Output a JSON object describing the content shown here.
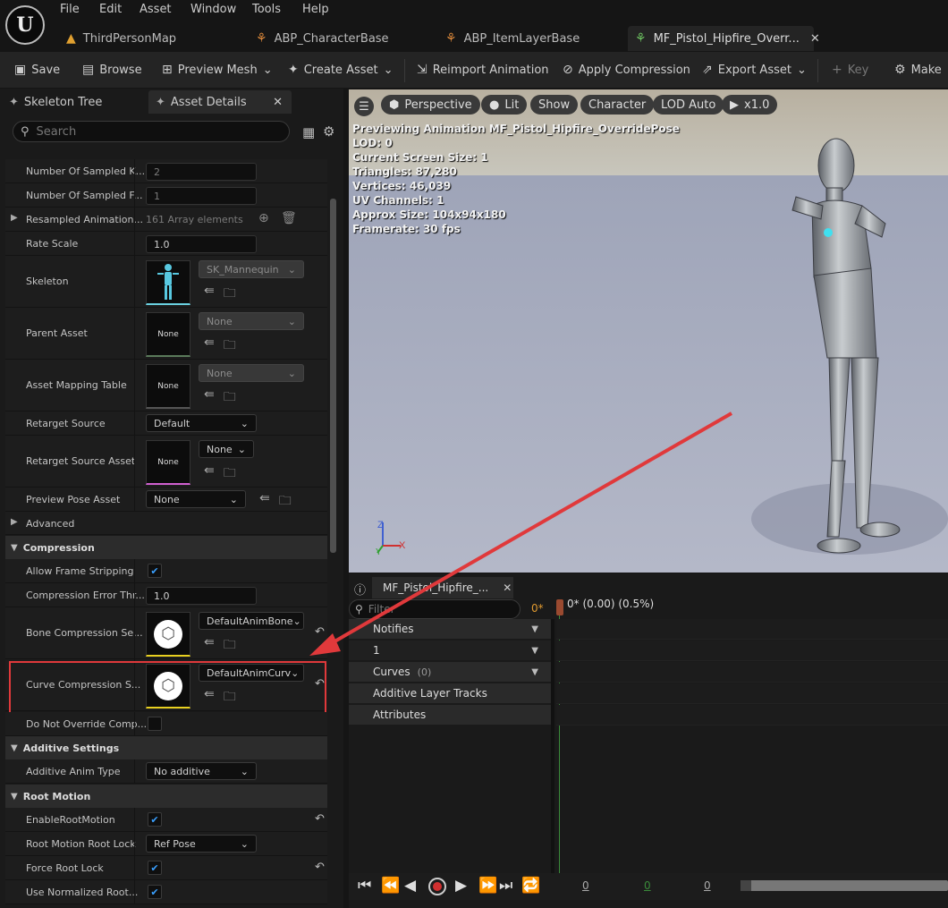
{
  "menu": [
    "File",
    "Edit",
    "Asset",
    "Window",
    "Tools",
    "Help"
  ],
  "tabs": [
    {
      "label": "ThirdPersonMap",
      "icon": "map-icon"
    },
    {
      "label": "ABP_CharacterBase",
      "icon": "anim-blueprint-icon"
    },
    {
      "label": "ABP_ItemLayerBase",
      "icon": "anim-blueprint-icon"
    },
    {
      "label": "MF_Pistol_Hipfire_Overr...",
      "icon": "animation-sequence-icon",
      "close": "✕"
    }
  ],
  "toolbar": {
    "save": "Save",
    "browse": "Browse",
    "preview_mesh": "Preview Mesh",
    "create_asset": "Create Asset",
    "reimport": "Reimport Animation",
    "apply_compression": "Apply Compression",
    "export_asset": "Export Asset",
    "key": "Key",
    "make": "Make"
  },
  "panel": {
    "tab_skeleton": "Skeleton Tree",
    "tab_details": "Asset Details",
    "close": "✕",
    "search_placeholder": "Search",
    "rows": {
      "sampled_keys": {
        "label": "Number Of Sampled K...",
        "value": "2"
      },
      "sampled_frames": {
        "label": "Number Of Sampled F...",
        "value": "1"
      },
      "resampled": {
        "label": "Resampled Animation...",
        "value": "161 Array elements"
      },
      "rate_scale": {
        "label": "Rate Scale",
        "value": "1.0"
      },
      "skeleton": {
        "label": "Skeleton",
        "value": "SK_Mannequin"
      },
      "parent_asset": {
        "label": "Parent Asset",
        "value": "None",
        "thumb": "None"
      },
      "mapping_table": {
        "label": "Asset Mapping Table",
        "value": "None",
        "thumb": "None"
      },
      "retarget_source": {
        "label": "Retarget Source",
        "value": "Default"
      },
      "retarget_source_asset": {
        "label": "Retarget Source Asset",
        "value": "None",
        "thumb": "None"
      },
      "preview_pose": {
        "label": "Preview Pose Asset",
        "value": "None"
      },
      "advanced": {
        "label": "Advanced"
      },
      "allow_frame_stripping": {
        "label": "Allow Frame Stripping",
        "checked": true
      },
      "compression_error": {
        "label": "Compression Error Thr...",
        "value": "1.0"
      },
      "bone_compression": {
        "label": "Bone Compression Se...",
        "value": "DefaultAnimBone"
      },
      "curve_compression": {
        "label": "Curve Compression S...",
        "value": "DefaultAnimCurv"
      },
      "do_not_override": {
        "label": "Do Not Override Comp...",
        "checked": false
      },
      "additive_type": {
        "label": "Additive Anim Type",
        "value": "No additive"
      },
      "enable_root_motion": {
        "label": "EnableRootMotion",
        "checked": true
      },
      "root_lock": {
        "label": "Root Motion Root Lock",
        "value": "Ref Pose"
      },
      "force_root_lock": {
        "label": "Force Root Lock",
        "checked": true
      },
      "normalized_root": {
        "label": "Use Normalized Root...",
        "checked": true
      }
    },
    "sections": {
      "compression": "Compression",
      "additive": "Additive Settings",
      "root_motion": "Root Motion"
    }
  },
  "viewport": {
    "perspective": "Perspective",
    "lit": "Lit",
    "show": "Show",
    "character": "Character",
    "lod": "LOD Auto",
    "speed": "x1.0",
    "stats": [
      "Previewing Animation MF_Pistol_Hipfire_OverridePose",
      "LOD: 0",
      "Current Screen Size: 1",
      "Triangles: 87,280",
      "Vertices: 46,039",
      "UV Channels: 1",
      "Approx Size: 104x94x180",
      "Framerate: 30 fps"
    ],
    "axis_z": "Z",
    "axis_x": "X",
    "axis_y": "Y"
  },
  "timeline": {
    "tab": "MF_Pistol_Hipfire_...",
    "close": "✕",
    "filter_placeholder": "Filter",
    "frame": "0*",
    "time_label": "0* (0.00) (0.5%)",
    "tracks": {
      "notifies": "Notifies",
      "notify_one": "1",
      "curves": "Curves",
      "curves_count": "(0)",
      "additive": "Additive Layer Tracks",
      "attributes": "Attributes"
    },
    "counters": [
      "0",
      "0",
      "0"
    ]
  },
  "colors": {
    "highlight": "#e0393b",
    "accent_blue": "#3aa0ff",
    "viewport_bg": "#9aa0b4"
  }
}
